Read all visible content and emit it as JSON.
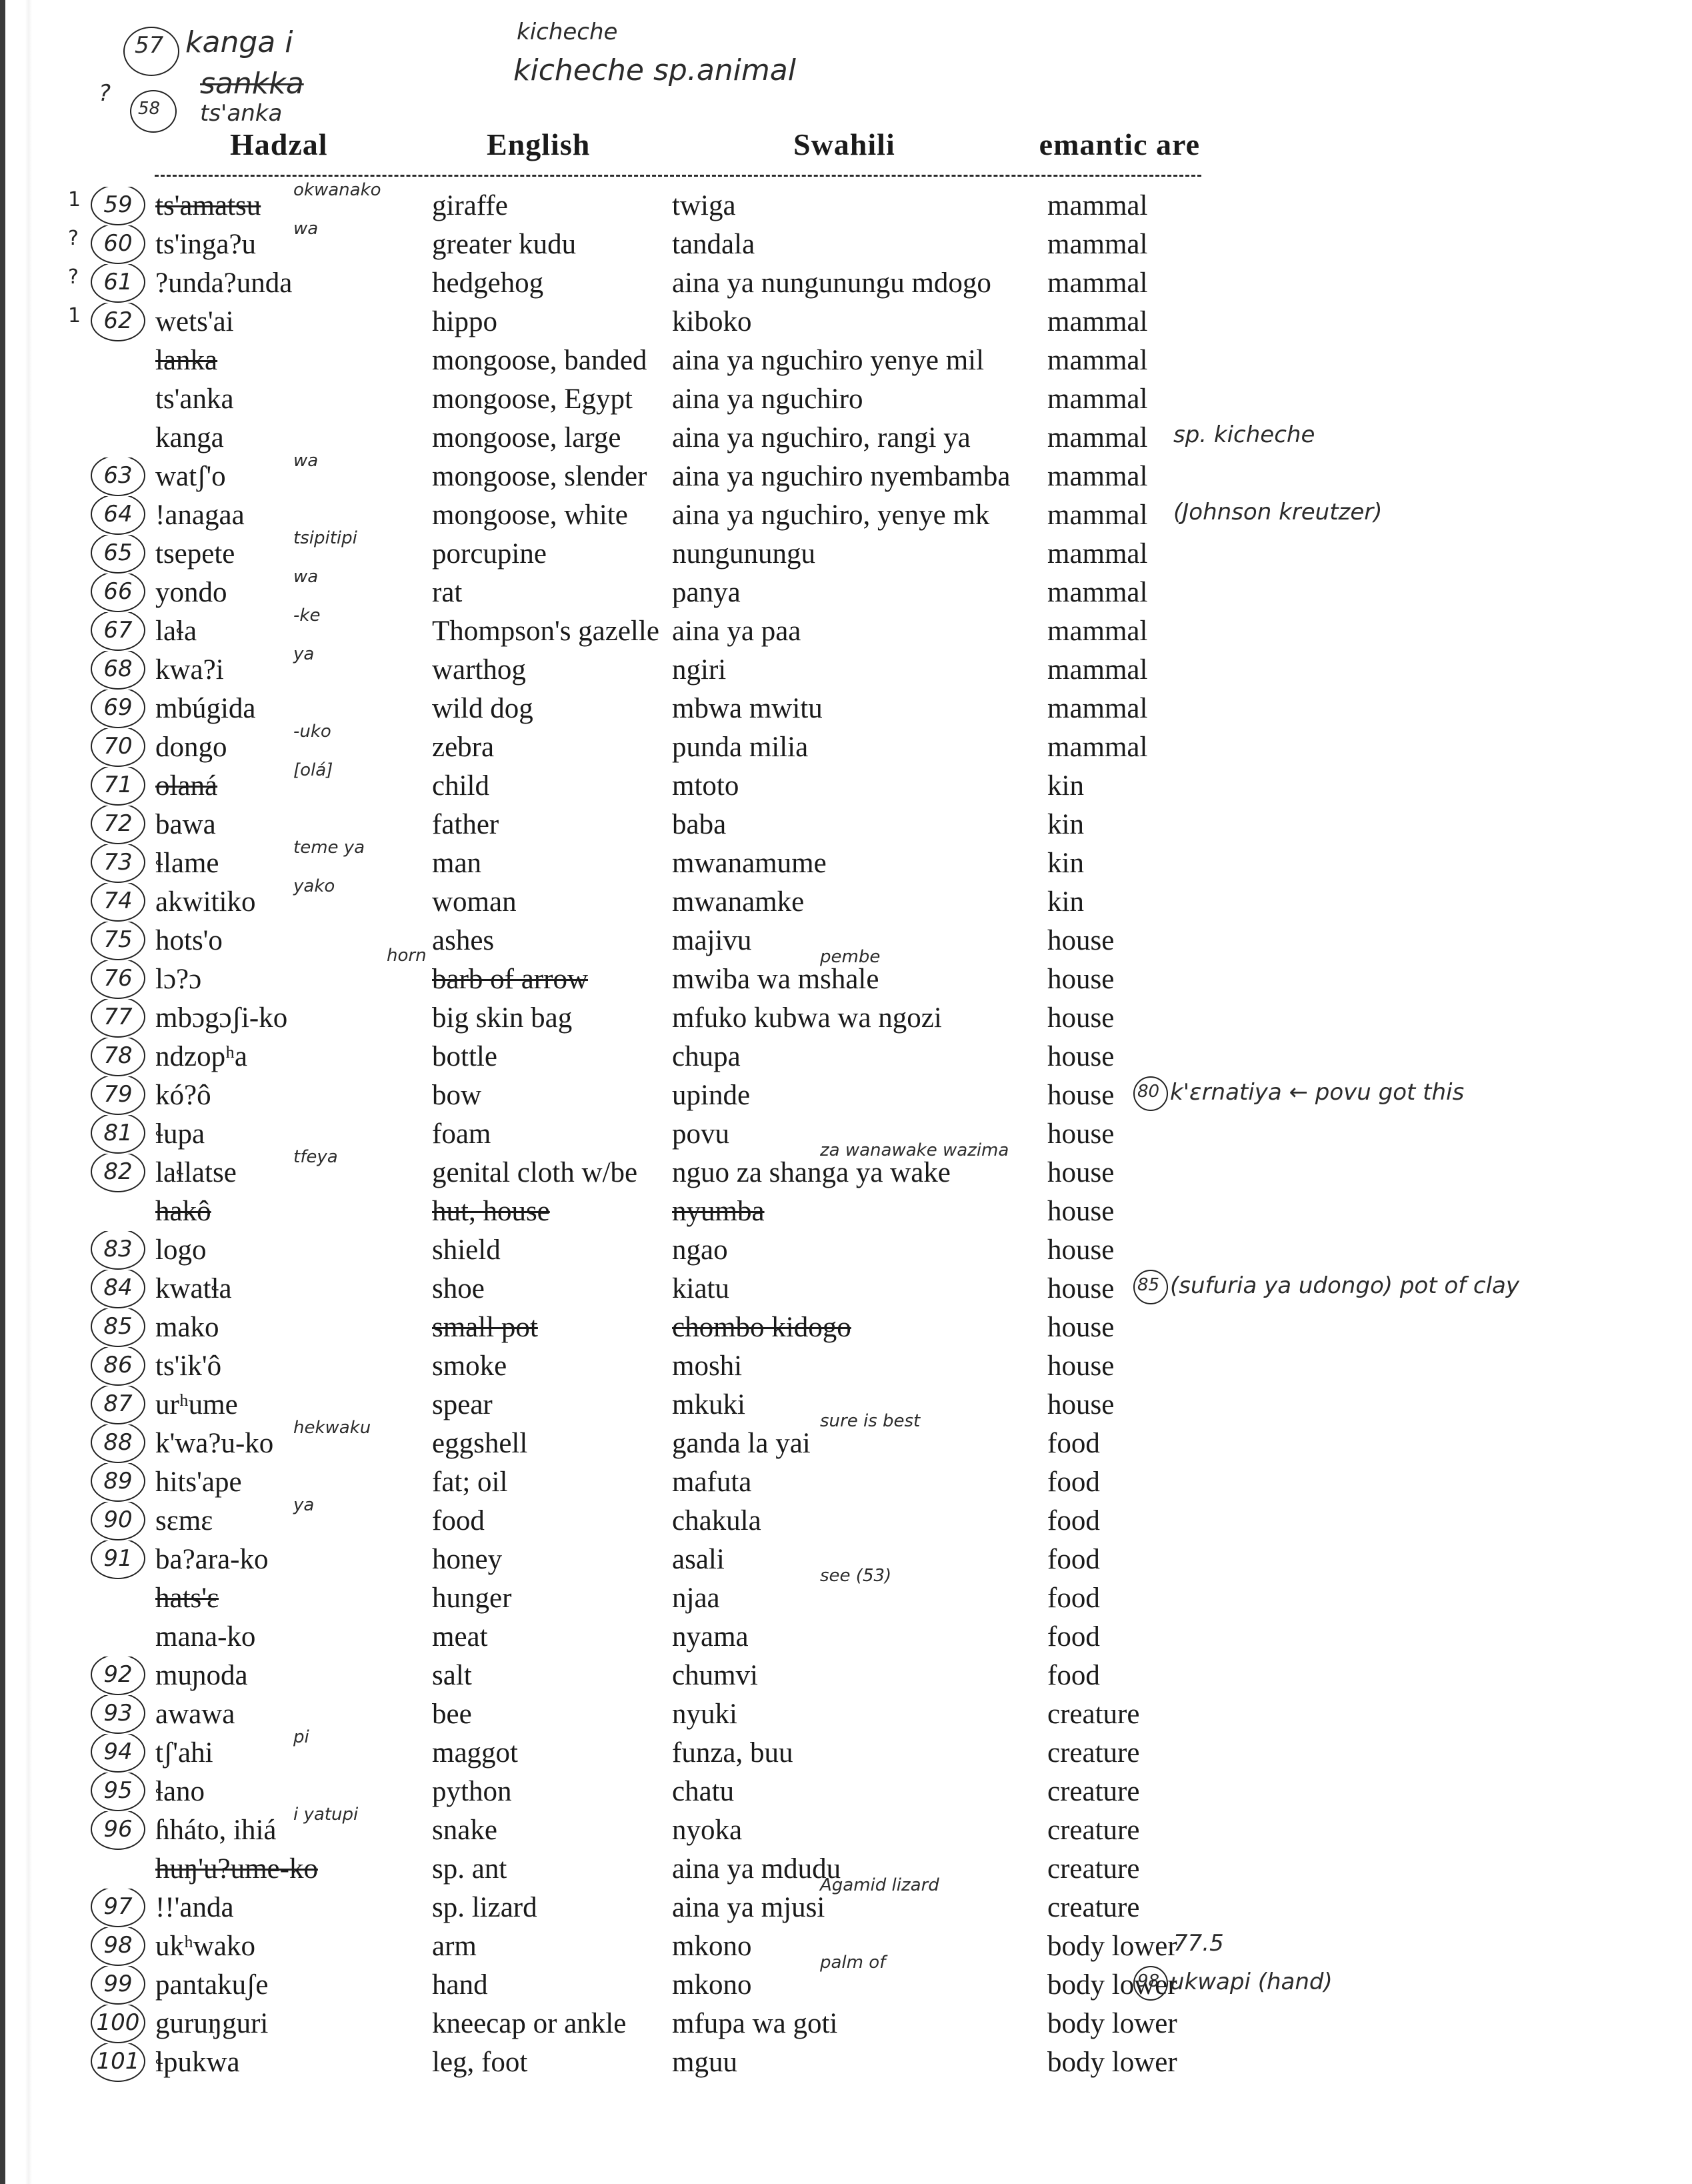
{
  "document": {
    "type": "scanned annotated wordlist",
    "headers": [
      "Hadzal",
      "English",
      "Swahili",
      "emantic are"
    ],
    "top_notes": [
      {
        "num": "57",
        "text": "kanga i"
      },
      {
        "num": "58",
        "mark": "?",
        "struck": "sankka",
        "text": "ts'anka"
      },
      {
        "text": "kicheche"
      },
      {
        "text": "kicheche  sp.animal"
      }
    ],
    "rows": [
      {
        "num": "59",
        "mark": "1",
        "hadza": "ts'amatsu",
        "hadza_struck": true,
        "hadza_note": "okwanako",
        "english": "giraffe",
        "swahili": "twiga",
        "semantic": "mammal"
      },
      {
        "num": "60",
        "mark": "?",
        "hadza": "ts'inga?u",
        "hadza_note": "wa",
        "english": "greater kudu",
        "swahili": "tandala",
        "semantic": "mammal"
      },
      {
        "num": "61",
        "mark": "?",
        "hadza": "?unda?unda",
        "english": "hedgehog",
        "swahili": "aina ya nungunungu mdogo",
        "semantic": "mammal"
      },
      {
        "num": "62",
        "mark": "1",
        "hadza": "wets'ai",
        "english": "hippo",
        "swahili": "kiboko",
        "semantic": "mammal"
      },
      {
        "num": "",
        "hadza": "lanka",
        "hadza_struck": true,
        "english": "mongoose, banded",
        "swahili": "aina ya nguchiro yenye mil",
        "semantic": "mammal"
      },
      {
        "num": "",
        "hadza": "ts'anka",
        "english": "mongoose, Egypt",
        "swahili": "aina ya nguchiro",
        "semantic": "mammal"
      },
      {
        "num": "",
        "hadza": "kanga",
        "english": "mongoose, large",
        "swahili": "aina ya nguchiro, rangi ya",
        "semantic": "mammal",
        "right_note": "sp. kicheche"
      },
      {
        "num": "63",
        "hadza": "watʃ'o",
        "hadza_note": "wa",
        "english": "mongoose, slender",
        "swahili": "aina ya nguchiro nyembamba",
        "semantic": "mammal"
      },
      {
        "num": "64",
        "hadza": "!anagaa",
        "english": "mongoose, white",
        "swahili": "aina ya nguchiro, yenye mk",
        "semantic": "mammal",
        "right_note": "(Johnson kreutzer)"
      },
      {
        "num": "65",
        "hadza": "tsepete",
        "hadza_note": "tsipitipi",
        "english": "porcupine",
        "swahili": "nungunungu",
        "semantic": "mammal"
      },
      {
        "num": "66",
        "hadza": "yondo",
        "hadza_note": "wa",
        "english": "rat",
        "swahili": "panya",
        "semantic": "mammal"
      },
      {
        "num": "67",
        "hadza": "laɬa",
        "hadza_note": "-ke",
        "english": "Thompson's gazelle",
        "swahili": "aina ya paa",
        "semantic": "mammal"
      },
      {
        "num": "68",
        "hadza": "kwa?i",
        "hadza_note": "ya",
        "english": "warthog",
        "swahili": "ngiri",
        "semantic": "mammal"
      },
      {
        "num": "69",
        "hadza": "mbúgida",
        "english": "wild dog",
        "swahili": "mbwa mwitu",
        "semantic": "mammal"
      },
      {
        "num": "70",
        "hadza": "dongo",
        "hadza_note": "-uko",
        "english": "zebra",
        "swahili": "punda milia",
        "semantic": "mammal"
      },
      {
        "num": "71",
        "hadza": "olaná",
        "hadza_struck": true,
        "hadza_note": "[olá]",
        "english": "child",
        "swahili": "mtoto",
        "semantic": "kin"
      },
      {
        "num": "72",
        "hadza": "bawa",
        "english": "father",
        "swahili": "baba",
        "semantic": "kin"
      },
      {
        "num": "73",
        "hadza": "ɬlame",
        "hadza_note": "teme ya",
        "english": "man",
        "swahili": "mwanamume",
        "semantic": "kin"
      },
      {
        "num": "74",
        "hadza": "akwitiko",
        "hadza_note": "yako",
        "english": "woman",
        "swahili": "mwanamke",
        "semantic": "kin"
      },
      {
        "num": "75",
        "hadza": "hots'o",
        "english": "ashes",
        "swahili": "majivu",
        "semantic": "house"
      },
      {
        "num": "76",
        "hadza": "lɔ?ɔ",
        "english": "barb of arrow",
        "english_struck": true,
        "english_note": "horn",
        "swahili": "mwiba wa mshale",
        "swahili_note": "pembe",
        "semantic": "house"
      },
      {
        "num": "77",
        "hadza": "mbɔgɔʃi-ko",
        "english": "big skin bag",
        "swahili": "mfuko kubwa wa ngozi",
        "semantic": "house"
      },
      {
        "num": "78",
        "hadza": "ndzopʰa",
        "english": "bottle",
        "swahili": "chupa",
        "semantic": "house"
      },
      {
        "num": "79",
        "hadza": "kó?ô",
        "english": "bow",
        "swahili": "upinde",
        "semantic": "house",
        "right_note_num": "80",
        "right_note": "k'ɛrnatiya ← povu got this"
      },
      {
        "num": "81",
        "hadza": "ɬupa",
        "english": "foam",
        "swahili": "povu",
        "semantic": "house"
      },
      {
        "num": "82",
        "hadza": "laɬlatse",
        "hadza_note": "tfeya",
        "english": "genital cloth w/be",
        "swahili": "nguo za shanga ya wake",
        "swahili_note": "za wanawake wazima",
        "semantic": "house"
      },
      {
        "num": "",
        "hadza": "hakô",
        "hadza_struck": true,
        "english": "hut, house",
        "english_struck": true,
        "swahili": "nyumba",
        "swahili_struck": true,
        "semantic": "house"
      },
      {
        "num": "83",
        "hadza": "logo",
        "english": "shield",
        "swahili": "ngao",
        "semantic": "house"
      },
      {
        "num": "84",
        "hadza": "kwatɬa",
        "english": "shoe",
        "swahili": "kiatu",
        "semantic": "house",
        "right_note_num": "85",
        "right_note": "(sufuria ya udongo) pot of clay"
      },
      {
        "num": "85",
        "hadza": "mako",
        "english": "small pot",
        "english_struck": true,
        "swahili": "chombo kidogo",
        "swahili_struck": true,
        "semantic": "house"
      },
      {
        "num": "86",
        "hadza": "ts'ik'ô",
        "english": "smoke",
        "swahili": "moshi",
        "semantic": "house"
      },
      {
        "num": "87",
        "hadza": "urʰume",
        "english": "spear",
        "swahili": "mkuki",
        "semantic": "house"
      },
      {
        "num": "88",
        "hadza": "k'wa?u-ko",
        "hadza_note": "hekwaku",
        "english": "eggshell",
        "swahili": "ganda la yai",
        "swahili_note": "sure is best",
        "semantic": "food"
      },
      {
        "num": "89",
        "hadza": "hits'ape",
        "english": "fat; oil",
        "swahili": "mafuta",
        "semantic": "food"
      },
      {
        "num": "90",
        "hadza": "sɛmɛ",
        "hadza_note": "ya",
        "english": "food",
        "swahili": "chakula",
        "semantic": "food"
      },
      {
        "num": "91",
        "hadza": "ba?ara-ko",
        "english": "honey",
        "swahili": "asali",
        "semantic": "food"
      },
      {
        "num": "",
        "hadza": "hats'ɛ",
        "hadza_struck": true,
        "english": "hunger",
        "swahili": "njaa",
        "swahili_note": "see (53)",
        "semantic": "food"
      },
      {
        "num": "",
        "hadza": "mana-ko",
        "english": "meat",
        "swahili": "nyama",
        "semantic": "food"
      },
      {
        "num": "92",
        "hadza": "muɲoda",
        "english": "salt",
        "swahili": "chumvi",
        "semantic": "food"
      },
      {
        "num": "93",
        "hadza": "awawa",
        "english": "bee",
        "swahili": "nyuki",
        "semantic": "creature"
      },
      {
        "num": "94",
        "hadza": "tʃ'ahi",
        "hadza_note": "pi",
        "english": "maggot",
        "swahili": "funza, buu",
        "semantic": "creature"
      },
      {
        "num": "95",
        "hadza": "ɬano",
        "english": "python",
        "swahili": "chatu",
        "semantic": "creature"
      },
      {
        "num": "96",
        "hadza": "ɦháto, ihiá",
        "hadza_note": "i yatupi",
        "english": "snake",
        "swahili": "nyoka",
        "semantic": "creature"
      },
      {
        "num": "",
        "hadza": "huŋ'u?ume-ko",
        "hadza_struck": true,
        "english": "sp. ant",
        "swahili": "aina ya mdudu",
        "semantic": "creature"
      },
      {
        "num": "97",
        "hadza": "!!'anda",
        "english": "sp. lizard",
        "swahili": "aina ya mjusi",
        "swahili_note": "Agamid lizard",
        "semantic": "creature"
      },
      {
        "num": "98",
        "hadza": "ukʰwako",
        "english": "arm",
        "swahili": "mkono",
        "semantic": "body lower",
        "right_note": "77.5"
      },
      {
        "num": "99",
        "hadza": "pantakuʃe",
        "english": "hand",
        "swahili": "mkono",
        "swahili_note": "palm of",
        "semantic": "body lower",
        "right_note_num": "98",
        "right_note": "ukwapi (hand)"
      },
      {
        "num": "100",
        "hadza": "guruŋguri",
        "english": "kneecap or ankle",
        "swahili": "mfupa wa goti",
        "semantic": "body lower"
      },
      {
        "num": "101",
        "hadza": "ɬpukwa",
        "english": "leg, foot",
        "swahili": "mguu",
        "semantic": "body lower"
      }
    ]
  }
}
